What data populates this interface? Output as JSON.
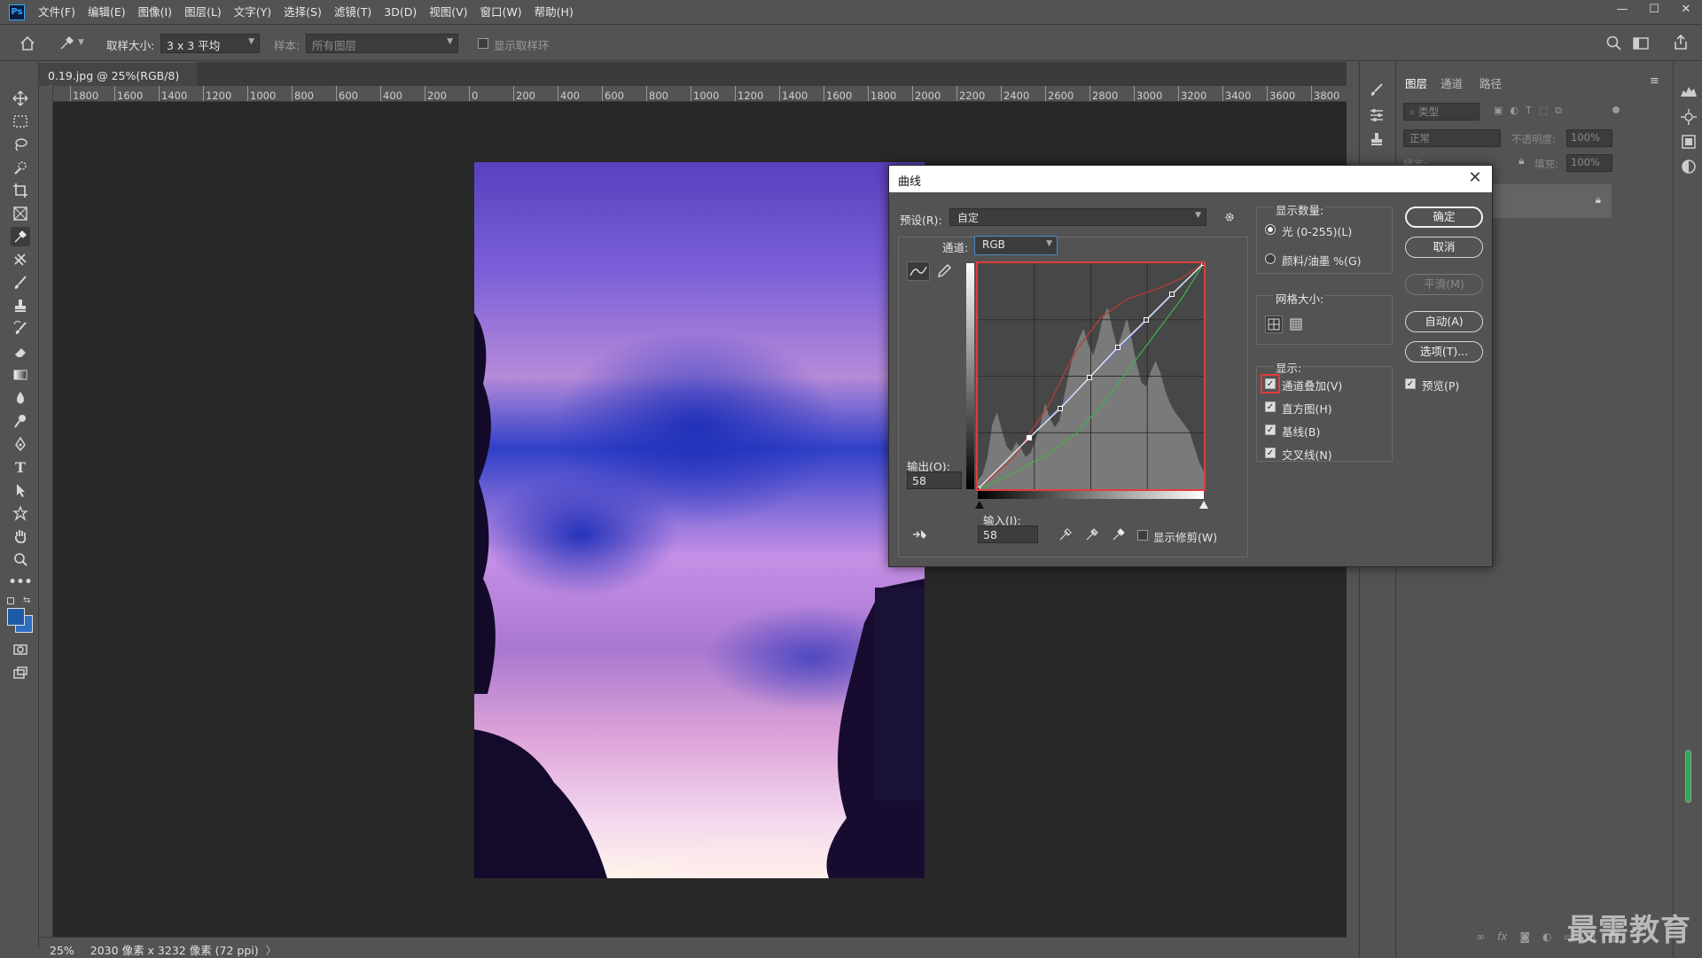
{
  "app": {
    "logo": "Ps"
  },
  "menu": [
    "文件(F)",
    "编辑(E)",
    "图像(I)",
    "图层(L)",
    "文字(Y)",
    "选择(S)",
    "滤镜(T)",
    "3D(D)",
    "视图(V)",
    "窗口(W)",
    "帮助(H)"
  ],
  "window_controls": {
    "minimize": "—",
    "maximize": "☐",
    "close": "✕"
  },
  "options": {
    "sample_size_label": "取样大小:",
    "sample_size_value": "3 x 3 平均",
    "sample_label": "样本:",
    "sample_value": "所有图层",
    "show_ring_label": "显示取样环"
  },
  "document_tab": {
    "title": "0.19.jpg @ 25%(RGB/8) *",
    "close": "×"
  },
  "ruler_top_labels": [
    "1800",
    "1600",
    "1400",
    "1200",
    "1000",
    "800",
    "600",
    "400",
    "200",
    "0",
    "200",
    "400",
    "600",
    "800",
    "1000",
    "1200",
    "1400",
    "1600",
    "1800",
    "2000",
    "2200",
    "2400",
    "2600",
    "2800",
    "3000",
    "3200",
    "3400",
    "3600",
    "3800"
  ],
  "status": {
    "zoom": "25%",
    "info": "2030 像素 x 3232 像素 (72 ppi)"
  },
  "layers_panel": {
    "tabs": [
      "图层",
      "通道",
      "路径"
    ],
    "filter_placeholder": "类型",
    "blend_mode": "正常",
    "opacity_label": "不透明度:",
    "opacity_value": "100%",
    "lock_label": "锁定:",
    "fill_label": "填充:",
    "fill_value": "100%"
  },
  "curves": {
    "title": "曲线",
    "preset_label": "预设(R):",
    "preset_value": "自定",
    "channel_label": "通道:",
    "channel_value": "RGB",
    "output_label": "输出(O):",
    "output_value": "58",
    "input_label": "输入(I):",
    "input_value": "58",
    "show_clipping_label": "显示修剪(W)",
    "display_amount": {
      "heading": "显示数量:",
      "light": "光 (0-255)(L)",
      "pigment": "颜料/油墨 %(G)",
      "selected": "light"
    },
    "grid_size": {
      "heading": "网格大小:"
    },
    "show": {
      "heading": "显示:",
      "channel_overlays": "通道叠加(V)",
      "histogram": "直方图(H)",
      "baseline": "基线(B)",
      "intersection": "交叉线(N)"
    },
    "buttons": {
      "ok": "确定",
      "cancel": "取消",
      "smooth": "平滑(M)",
      "auto": "自动(A)",
      "options": "选项(T)..."
    },
    "preview_label": "预览(P)",
    "checked": "✓"
  },
  "chart_data": {
    "type": "line",
    "xlim": [
      0,
      255
    ],
    "ylim": [
      0,
      255
    ],
    "grid": true,
    "series": [
      {
        "color": "#e6e6e6",
        "x": [
          0,
          58,
          93,
          126,
          158,
          190,
          219,
          255
        ],
        "y": [
          0,
          58,
          91,
          126,
          160,
          191,
          220,
          255
        ]
      },
      {
        "color": "#c23a3a",
        "x": [
          0,
          40,
          80,
          110,
          140,
          170,
          200,
          230,
          255
        ],
        "y": [
          0,
          35,
          95,
          155,
          195,
          215,
          225,
          238,
          255
        ]
      },
      {
        "color": "#3fb24a",
        "x": [
          0,
          40,
          80,
          110,
          140,
          170,
          200,
          230,
          255
        ],
        "y": [
          0,
          18,
          40,
          62,
          95,
          135,
          175,
          215,
          255
        ]
      },
      {
        "color": "#5a78e0",
        "x": [
          0,
          128,
          255
        ],
        "y": [
          0,
          128,
          255
        ]
      }
    ],
    "control_points": {
      "x": [
        0,
        58,
        93,
        126,
        158,
        190,
        219,
        255
      ],
      "y": [
        0,
        58,
        91,
        126,
        160,
        191,
        220,
        255
      ]
    },
    "histogram": [
      8,
      14,
      30,
      60,
      72,
      55,
      40,
      35,
      44,
      38,
      30,
      34,
      46,
      60,
      80,
      66,
      58,
      64,
      88,
      110,
      128,
      140,
      150,
      135,
      125,
      140,
      160,
      170,
      150,
      132,
      145,
      160,
      140,
      118,
      100,
      96,
      110,
      120,
      108,
      92,
      80,
      72,
      66,
      60,
      54,
      40,
      26,
      16
    ]
  },
  "watermark": "最需教育"
}
